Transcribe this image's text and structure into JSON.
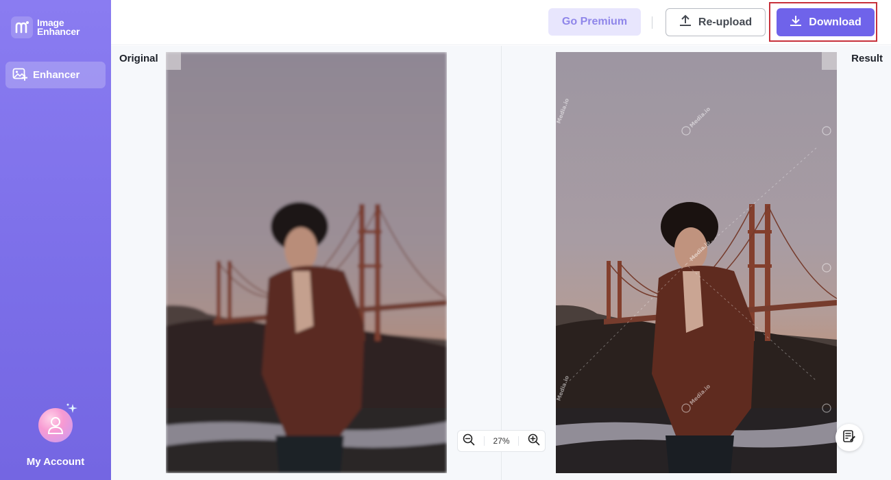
{
  "app": {
    "name": "Image Enhancer"
  },
  "sidebar": {
    "nav_item_label": "Enhancer",
    "account_label": "My Account"
  },
  "toolbar": {
    "premium_label": "Go Premium",
    "reupload_label": "Re-upload",
    "download_label": "Download"
  },
  "workspace": {
    "original_label": "Original",
    "result_label": "Result",
    "zoom_level": "27%",
    "watermark_text": "Media.io"
  },
  "colors": {
    "accent": "#6f63ea",
    "sidebar": "#7b6ee8",
    "highlight_frame": "#c7303a"
  },
  "icons": [
    "logo-icon",
    "enhancer-icon",
    "upload-icon",
    "download-icon",
    "zoom-out-icon",
    "zoom-in-icon",
    "feedback-icon",
    "sparkle-icon"
  ]
}
